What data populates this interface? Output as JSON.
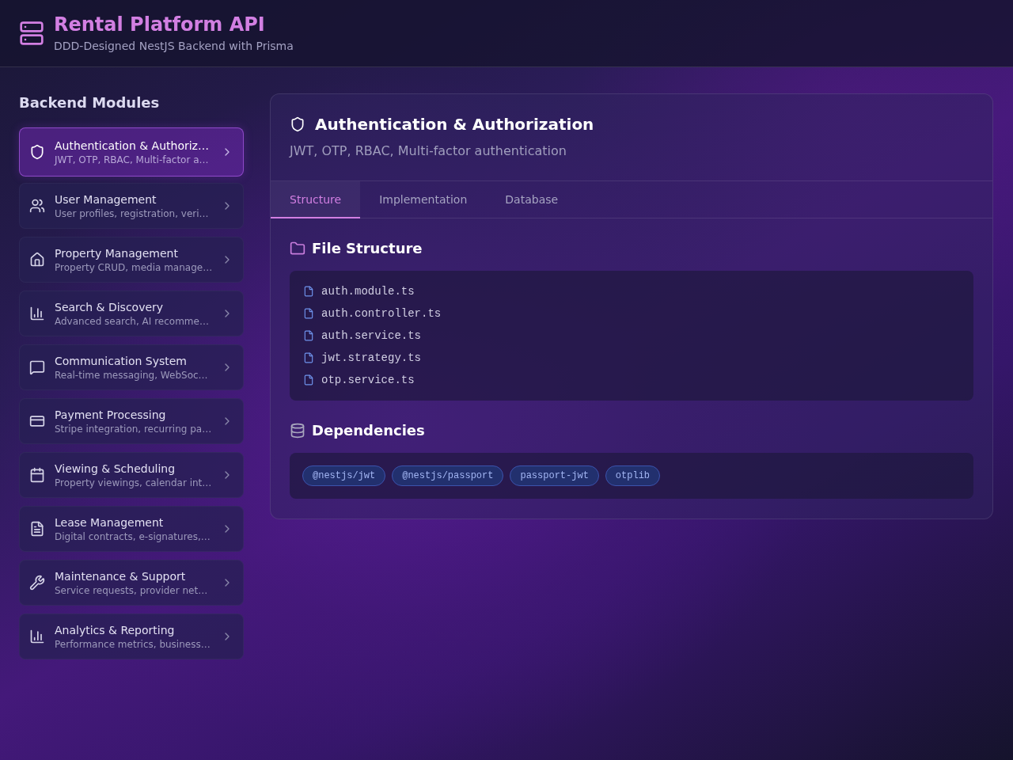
{
  "header": {
    "title": "Rental Platform API",
    "subtitle": "DDD-Designed NestJS Backend with Prisma"
  },
  "sidebar": {
    "heading": "Backend Modules",
    "modules": [
      {
        "title": "Authentication & Authoriz…",
        "description": "JWT, OTP, RBAC, Multi-factor a…",
        "selected": true
      },
      {
        "title": "User Management",
        "description": "User profiles, registration, veri…",
        "selected": false
      },
      {
        "title": "Property Management",
        "description": "Property CRUD, media manage…",
        "selected": false
      },
      {
        "title": "Search & Discovery",
        "description": "Advanced search, AI recomme…",
        "selected": false
      },
      {
        "title": "Communication System",
        "description": "Real-time messaging, WebSoc…",
        "selected": false
      },
      {
        "title": "Payment Processing",
        "description": "Stripe integration, recurring pa…",
        "selected": false
      },
      {
        "title": "Viewing & Scheduling",
        "description": "Property viewings, calendar int…",
        "selected": false
      },
      {
        "title": "Lease Management",
        "description": "Digital contracts, e-signatures,…",
        "selected": false
      },
      {
        "title": "Maintenance & Support",
        "description": "Service requests, provider net…",
        "selected": false
      },
      {
        "title": "Analytics & Reporting",
        "description": "Performance metrics, business…",
        "selected": false
      }
    ]
  },
  "detail": {
    "title": "Authentication & Authorization",
    "description": "JWT, OTP, RBAC, Multi-factor authentication",
    "tabs": [
      {
        "label": "Structure",
        "selected": true
      },
      {
        "label": "Implementation",
        "selected": false
      },
      {
        "label": "Database",
        "selected": false
      }
    ],
    "file_structure": {
      "heading": "File Structure",
      "files": [
        "auth.module.ts",
        "auth.controller.ts",
        "auth.service.ts",
        "jwt.strategy.ts",
        "otp.service.ts"
      ]
    },
    "dependencies": {
      "heading": "Dependencies",
      "packages": [
        "@nestjs/jwt",
        "@nestjs/passport",
        "passport-jwt",
        "otplib"
      ]
    }
  }
}
